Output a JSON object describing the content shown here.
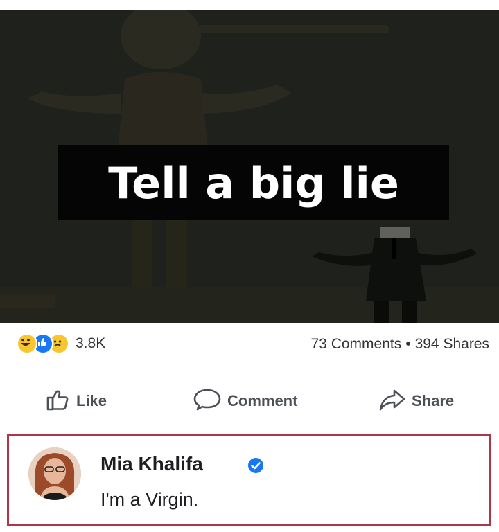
{
  "post": {
    "caption": "Tell a big lie"
  },
  "stats": {
    "reaction_icons": [
      "haha-icon",
      "like-icon",
      "sad-icon"
    ],
    "reaction_count": "3.8K",
    "comments": "73 Comments",
    "separator": "•",
    "shares": "394 Shares"
  },
  "actions": {
    "like_label": "Like",
    "comment_label": "Comment",
    "share_label": "Share"
  },
  "comment": {
    "author": "Mia Khalifa",
    "text": "I'm a Virgin.",
    "verified_color": "#1877f2"
  },
  "colors": {
    "highlight_border": "#b0354a",
    "image_background": "#1f211c",
    "caption_background": "#050505"
  }
}
